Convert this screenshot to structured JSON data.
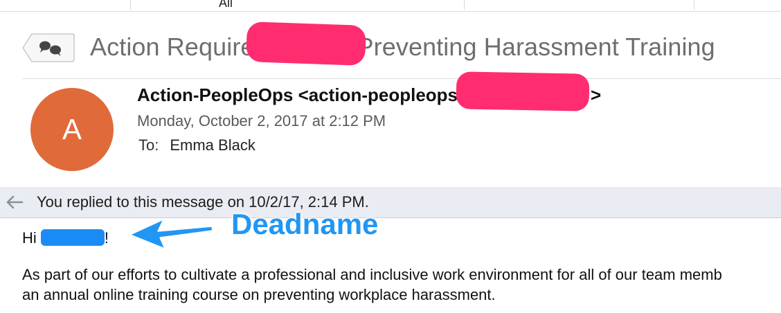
{
  "mailbox_list": {
    "all_label": "All"
  },
  "message": {
    "subject_prefix": "Action Require",
    "subject_suffix": "Preventing Harassment Training",
    "sender_name_prefix": "Action-PeopleOps <action-peopleops",
    "sender_suffix": ">",
    "avatar_letter": "A",
    "date": "Monday, October 2, 2017 at 2:12 PM",
    "to_label": "To:",
    "to_name": "Emma Black",
    "replied_notice": "You replied to this message on 10/2/17, 2:14 PM.",
    "greeting_prefix": "Hi ",
    "greeting_suffix": "!",
    "body_line_1": "As part of our efforts to cultivate a professional and inclusive work environment for all of our team memb",
    "body_line_2": "an annual online training course on preventing workplace harassment."
  },
  "annotation": {
    "label": "Deadname"
  },
  "colors": {
    "redaction_pink": "#ff2d6f",
    "redaction_blue": "#1b8cf5",
    "annotation_blue": "#2196f3",
    "avatar_orange": "#e06a3a",
    "banner_bg": "#e9ecf2"
  },
  "icons": {
    "conversation": "speech-bubbles-icon",
    "replied": "reply-arrow-icon",
    "annotation_pointer": "annotation-arrow-icon"
  }
}
